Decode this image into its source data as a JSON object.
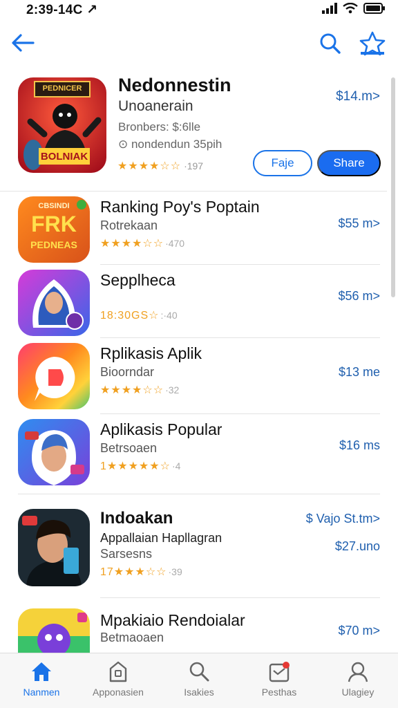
{
  "status": {
    "time": "2:39-14C ↗"
  },
  "featured": {
    "title": "Nedonnestin",
    "subtitle": "Unoanerain",
    "meta1": "Bronbers: $:6lle",
    "meta2": "⊙ nondendun 35pih",
    "rating_stars": "★★★★☆☆",
    "rating_count": "·197",
    "price": "$14.m>",
    "secondary_button": "Faje",
    "primary_button": "Share",
    "icon_banner": "PEDNICER",
    "icon_caption": "BOLNIAK"
  },
  "apps": [
    {
      "title": "Ranking Poy's Poptain",
      "subtitle": "Rotrekaan",
      "rating_stars": "★★★★☆☆",
      "rating_count": "·470",
      "price": "$55 m>",
      "icon_text_1": "CBSINDI",
      "icon_text_2": "FRK",
      "icon_text_3": "PEDNEAS"
    },
    {
      "title": "Sepplheca",
      "subtitle": "",
      "rating_stars": "18:30GS☆",
      "rating_count": ":·40",
      "price": "$56 m>"
    },
    {
      "title": "Rplikasis Aplik",
      "subtitle": "Bioorndar",
      "rating_stars": "★★★★☆☆",
      "rating_count": "·32",
      "price": "$13 me"
    },
    {
      "title": "Aplikasis Popular",
      "subtitle": "Betrsoaen",
      "rating_stars": "1★★★★★☆",
      "rating_count": "·4",
      "price": "$16 ms"
    },
    {
      "title": "Indoakan",
      "subtitle": "Appallaian Hapllagran",
      "subtitle2": "Sarsesns",
      "rating_stars": "17★★★☆☆",
      "rating_count": "·39",
      "price": "$ Vajo St.tm>",
      "price2": "$27.uno"
    },
    {
      "title": "Mpakiaio Rendoialar",
      "subtitle": "Betmaoaen",
      "rating_stars": "",
      "rating_count": "",
      "price": "$70 m>"
    }
  ],
  "tabs": [
    {
      "label": "Nanmen",
      "icon": "home-icon",
      "active": true
    },
    {
      "label": "Apponasien",
      "icon": "apps-icon",
      "active": false
    },
    {
      "label": "Isakies",
      "icon": "search-icon",
      "active": false
    },
    {
      "label": "Pesthas",
      "icon": "updates-icon",
      "active": false
    },
    {
      "label": "Ulagiey",
      "icon": "account-icon",
      "active": false
    }
  ],
  "colors": {
    "accent": "#1a73e8",
    "price": "#1f5fae",
    "star": "#f0a020"
  }
}
